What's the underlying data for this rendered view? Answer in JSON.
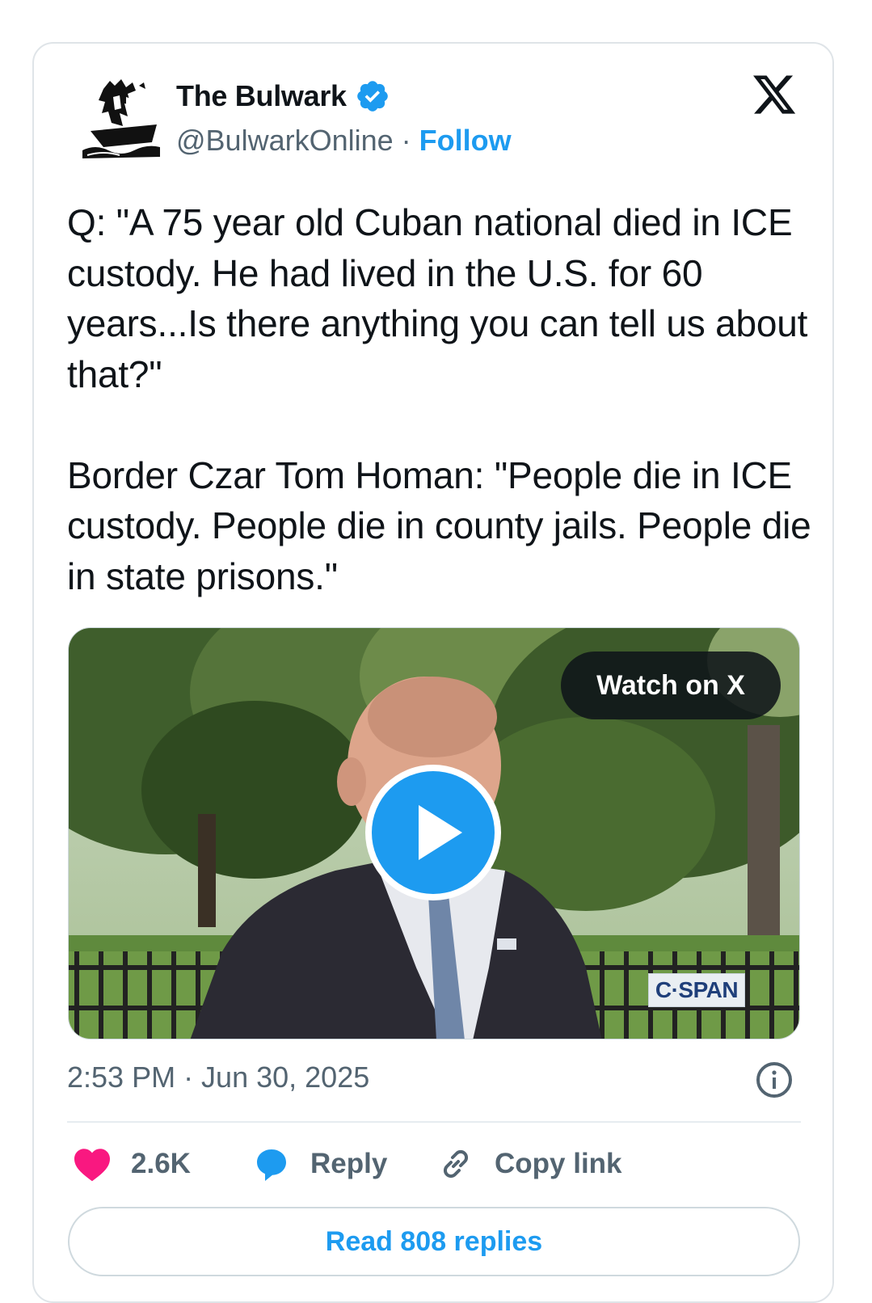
{
  "author": {
    "name": "The Bulwark",
    "handle": "@BulwarkOnline",
    "separator": " · ",
    "follow_label": "Follow",
    "verified": true,
    "avatar_icon": "pirate-ship-logo"
  },
  "brand_icon": "x-logo-icon",
  "tweet": {
    "text": "Q: \"A 75 year old Cuban national died in ICE custody. He had lived in the U.S. for 60 years...Is there anything you can tell us about that?\"\n\nBorder Czar Tom Homan: \"People die in ICE custody. People die in county jails. People die in state prisons.\""
  },
  "media": {
    "watch_label": "Watch on X",
    "watermark": "C·SPAN",
    "play_icon": "play-icon"
  },
  "timestamp": "2:53 PM · Jun 30, 2025",
  "actions": {
    "like_count": "2.6K",
    "reply_label": "Reply",
    "copy_label": "Copy link"
  },
  "read_replies_label": "Read 808 replies",
  "colors": {
    "accent": "#1d9bf0",
    "like": "#f91880",
    "muted": "#536471",
    "text": "#0f1419"
  }
}
